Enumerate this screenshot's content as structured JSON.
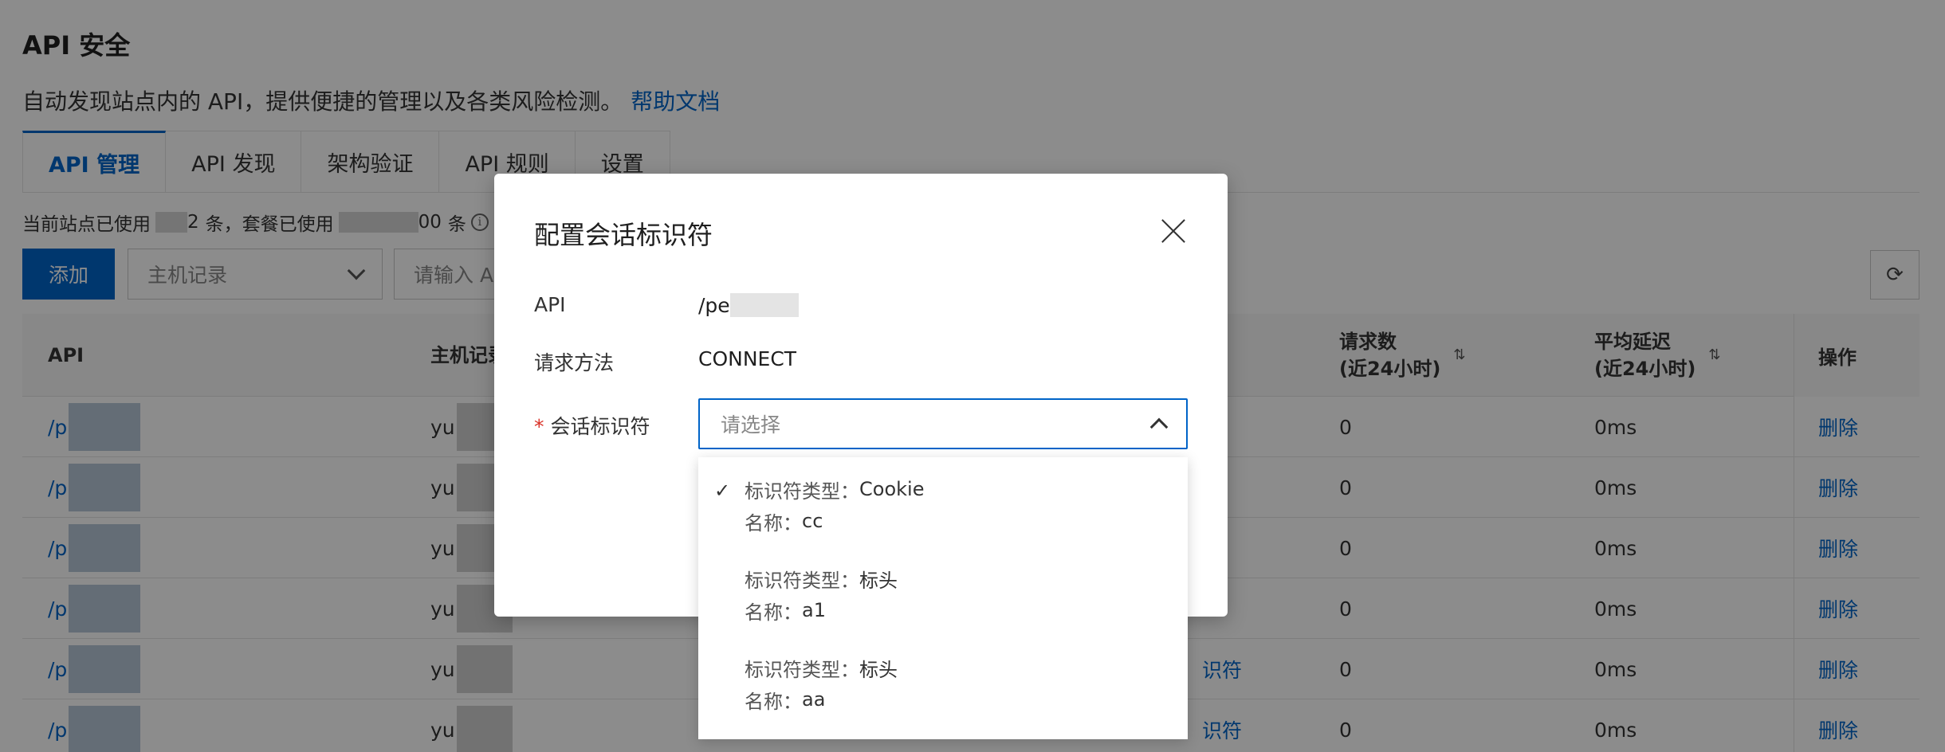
{
  "page": {
    "title": "API 安全",
    "description": "自动发现站点内的 API，提供便捷的管理以及各类风险检测。",
    "help_link": "帮助文档"
  },
  "tabs": [
    {
      "label": "API 管理",
      "active": true
    },
    {
      "label": "API 发现",
      "active": false
    },
    {
      "label": "架构验证",
      "active": false
    },
    {
      "label": "API 规则",
      "active": false
    },
    {
      "label": "设置",
      "active": false
    }
  ],
  "usage": {
    "prefix": "当前站点已使用",
    "site_count_tail": "2",
    "unit": "条，套餐已使用",
    "plan_count_tail": "00",
    "suffix": "条"
  },
  "toolbar": {
    "add_label": "添加",
    "host_select": "主机记录",
    "search_placeholder": "请输入 A"
  },
  "table": {
    "headers": {
      "api": "API",
      "host": "主机记录",
      "requests_line1": "请求数",
      "requests_line2": "(近24小时)",
      "latency_line1": "平均延迟",
      "latency_line2": "(近24小时)",
      "ops": "操作"
    },
    "rows": [
      {
        "api": "/p",
        "host": "yu",
        "link": "",
        "requests": "0",
        "latency": "0ms",
        "action": "删除"
      },
      {
        "api": "/p",
        "host": "yu",
        "link": "",
        "requests": "0",
        "latency": "0ms",
        "action": "删除"
      },
      {
        "api": "/p",
        "host": "yu",
        "link": "",
        "requests": "0",
        "latency": "0ms",
        "action": "删除"
      },
      {
        "api": "/p",
        "host": "yu",
        "link": "",
        "requests": "0",
        "latency": "0ms",
        "action": "删除"
      },
      {
        "api": "/p",
        "host": "yu",
        "link": "识符",
        "requests": "0",
        "latency": "0ms",
        "action": "删除"
      },
      {
        "api": "/p",
        "host": "yu",
        "link": "识符",
        "requests": "0",
        "latency": "0ms",
        "action": "删除"
      }
    ]
  },
  "modal": {
    "title": "配置会话标识符",
    "api_label": "API",
    "api_value": "/pe",
    "method_label": "请求方法",
    "method_value": "CONNECT",
    "identifier_required": "*",
    "identifier_label": "会话标识符",
    "identifier_placeholder": "请选择"
  },
  "dropdown": {
    "options": [
      {
        "type_key": "标识符类型：",
        "type_value": "Cookie",
        "name_key": "名称：",
        "name_value": "cc",
        "selected": true
      },
      {
        "type_key": "标识符类型：",
        "type_value": "标头",
        "name_key": "名称：",
        "name_value": "a1",
        "selected": false
      },
      {
        "type_key": "标识符类型：",
        "type_value": "标头",
        "name_key": "名称：",
        "name_value": "aa",
        "selected": false
      }
    ]
  },
  "icons": {
    "check": "check-icon",
    "close": "close-icon",
    "refresh": "refresh-icon",
    "info": "info-icon"
  },
  "colors": {
    "primary": "#0064c8",
    "required": "#d93026"
  }
}
